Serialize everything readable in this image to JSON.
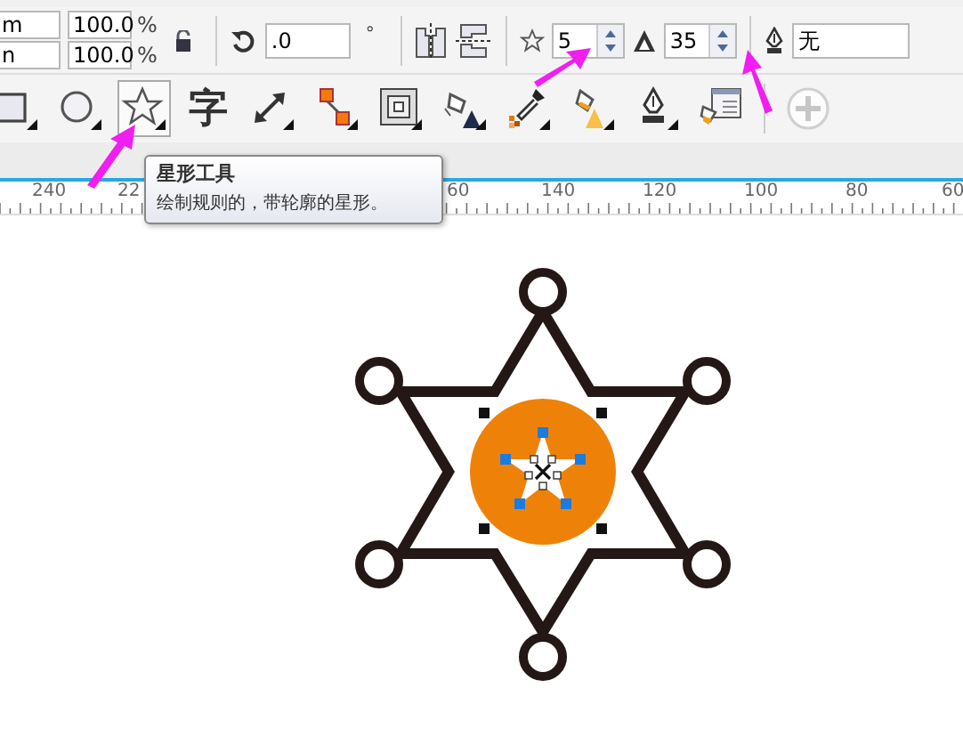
{
  "property_bar": {
    "size_units": [
      "m",
      "n"
    ],
    "scale": [
      {
        "value": "100.0",
        "unit": "%"
      },
      {
        "value": "100.0",
        "unit": "%"
      }
    ],
    "rotation": {
      "value": ".0",
      "unit": "°"
    },
    "points": {
      "value": "5"
    },
    "sharpness": {
      "value": "35"
    },
    "outline": {
      "value": "无"
    }
  },
  "toolbox": [
    {
      "kind": "rectangle",
      "selected": false,
      "disabled": false
    },
    {
      "kind": "ellipse",
      "selected": false,
      "disabled": false
    },
    {
      "kind": "star",
      "selected": true,
      "disabled": false
    },
    {
      "kind": "text",
      "label": "字",
      "selected": false,
      "disabled": false
    },
    {
      "kind": "dimension",
      "selected": false,
      "disabled": false
    },
    {
      "kind": "connector",
      "selected": false,
      "disabled": false
    },
    {
      "kind": "contour",
      "selected": false,
      "disabled": false
    },
    {
      "kind": "blend",
      "selected": false,
      "disabled": false
    },
    {
      "kind": "eyedropper",
      "selected": false,
      "disabled": false
    },
    {
      "kind": "fill",
      "selected": false,
      "disabled": false
    },
    {
      "kind": "pen",
      "selected": false,
      "disabled": false
    },
    {
      "kind": "fill-dialog",
      "selected": false,
      "disabled": false
    },
    {
      "kind": "add",
      "selected": false,
      "disabled": true
    }
  ],
  "tooltip": {
    "title": "星形工具",
    "description": "绘制规则的，带轮廓的星形。"
  },
  "ruler": {
    "labels": [
      "240",
      "22",
      "60",
      "140",
      "120",
      "100",
      "80",
      "60"
    ]
  }
}
